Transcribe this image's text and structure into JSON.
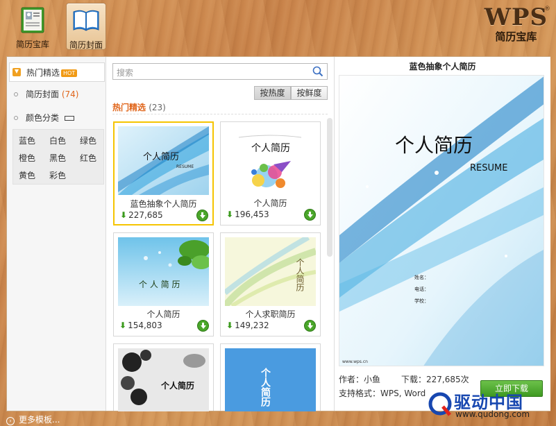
{
  "topbar": {
    "nav": [
      {
        "label": "简历宝库",
        "icon": "resume-book-icon"
      },
      {
        "label": "简历封面",
        "icon": "open-book-icon",
        "active": true
      }
    ],
    "logo_text": "WPS",
    "logo_reg": "®",
    "logo_sub": "简历宝库"
  },
  "sidebar": {
    "hot": {
      "label": "热门精选",
      "badge": "HOT"
    },
    "cover": {
      "label": "简历封面",
      "count": "(74)"
    },
    "colors": {
      "label": "颜色分类"
    },
    "color_items": [
      "蓝色",
      "白色",
      "绿色",
      "橙色",
      "黑色",
      "红色",
      "黄色",
      "彩色"
    ]
  },
  "middle": {
    "search_placeholder": "搜索",
    "sort": {
      "by_hot": "按热度",
      "by_fresh": "按鲜度"
    },
    "section_title": "热门精选",
    "section_count": "(23)",
    "cards": [
      {
        "title": "蓝色抽象个人简历",
        "downloads": "227,685",
        "thumb_text": "个人简历",
        "thumb_sub": "RESUME"
      },
      {
        "title": "个人简历",
        "downloads": "196,453",
        "thumb_text": "个人简历"
      },
      {
        "title": "个人简历",
        "downloads": "154,803",
        "thumb_text": "个 人 简 历"
      },
      {
        "title": "个人求职简历",
        "downloads": "149,232",
        "thumb_text": "个人简历"
      },
      {
        "title": "",
        "downloads": "",
        "thumb_text": "个人简历"
      },
      {
        "title": "",
        "downloads": "",
        "thumb_text": "个人简历"
      }
    ]
  },
  "preview": {
    "title": "蓝色抽象个人简历",
    "heading": "个人简历",
    "sub": "RESUME",
    "fields": [
      "姓名：",
      "电话：",
      "学校："
    ],
    "site": "www.wps.cn",
    "author": "作者：小鱼",
    "downloads": "下载：227,685次",
    "formats": "支持格式：WPS, Word",
    "download_btn": "立即下载"
  },
  "bottom": {
    "more": "更多模板..."
  },
  "watermark": {
    "name": "驱动中国",
    "url": "www.qudong.com"
  }
}
